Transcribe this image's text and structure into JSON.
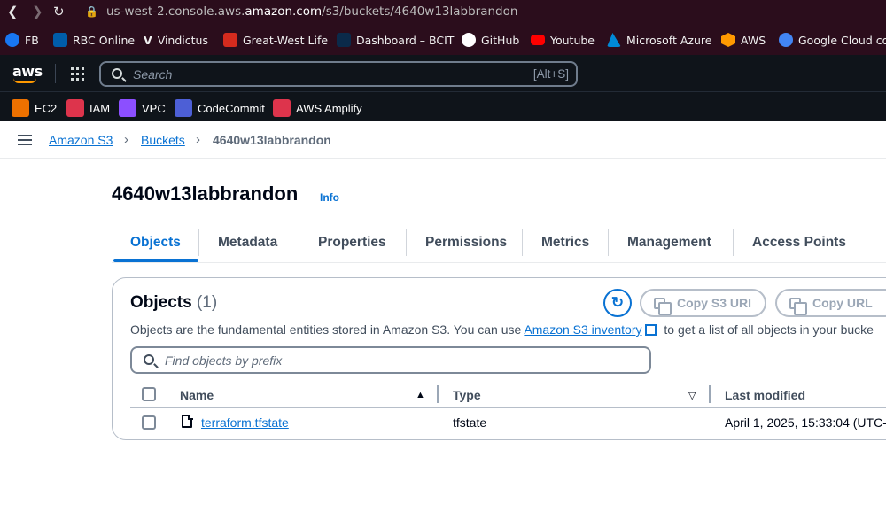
{
  "browser": {
    "url_prefix": "us-west-2.console.aws.",
    "url_domain": "amazon.com",
    "url_path": "/s3/buckets/4640w13labbrandon",
    "bookmarks": [
      "FB",
      "RBC Online",
      "Vindictus",
      "Great-West Life",
      "Dashboard – BCIT",
      "GitHub",
      "Youtube",
      "Microsoft Azure",
      "AWS",
      "Google Cloud cor"
    ]
  },
  "aws": {
    "logo": "aws",
    "search_placeholder": "Search",
    "search_shortcut": "[Alt+S]",
    "favorites": [
      "EC2",
      "IAM",
      "VPC",
      "CodeCommit",
      "AWS Amplify"
    ]
  },
  "breadcrumb": {
    "items": [
      "Amazon S3",
      "Buckets"
    ],
    "current": "4640w13labbrandon"
  },
  "page": {
    "title": "4640w13labbrandon",
    "info": "Info"
  },
  "tabs": [
    "Objects",
    "Metadata",
    "Properties",
    "Permissions",
    "Metrics",
    "Management",
    "Access Points"
  ],
  "objects": {
    "title": "Objects",
    "count": "(1)",
    "copy_s3_uri": "Copy S3 URI",
    "copy_url": "Copy URL",
    "desc_before": "Objects are the fundamental entities stored in Amazon S3. You can use",
    "desc_link": "Amazon S3 inventory",
    "desc_after": "to get a list of all objects in your bucke",
    "filter_placeholder": "Find objects by prefix",
    "columns": [
      "Name",
      "Type",
      "Last modified"
    ],
    "rows": [
      {
        "name": "terraform.tfstate",
        "type": "tfstate",
        "modified": "April 1, 2025, 15:33:04 (UTC-"
      }
    ]
  },
  "colors": {
    "accent": "#0972d3",
    "browser_bg": "#2b0d1c",
    "aws_bar": "#0f141a",
    "aws_orange": "#ff9900"
  }
}
